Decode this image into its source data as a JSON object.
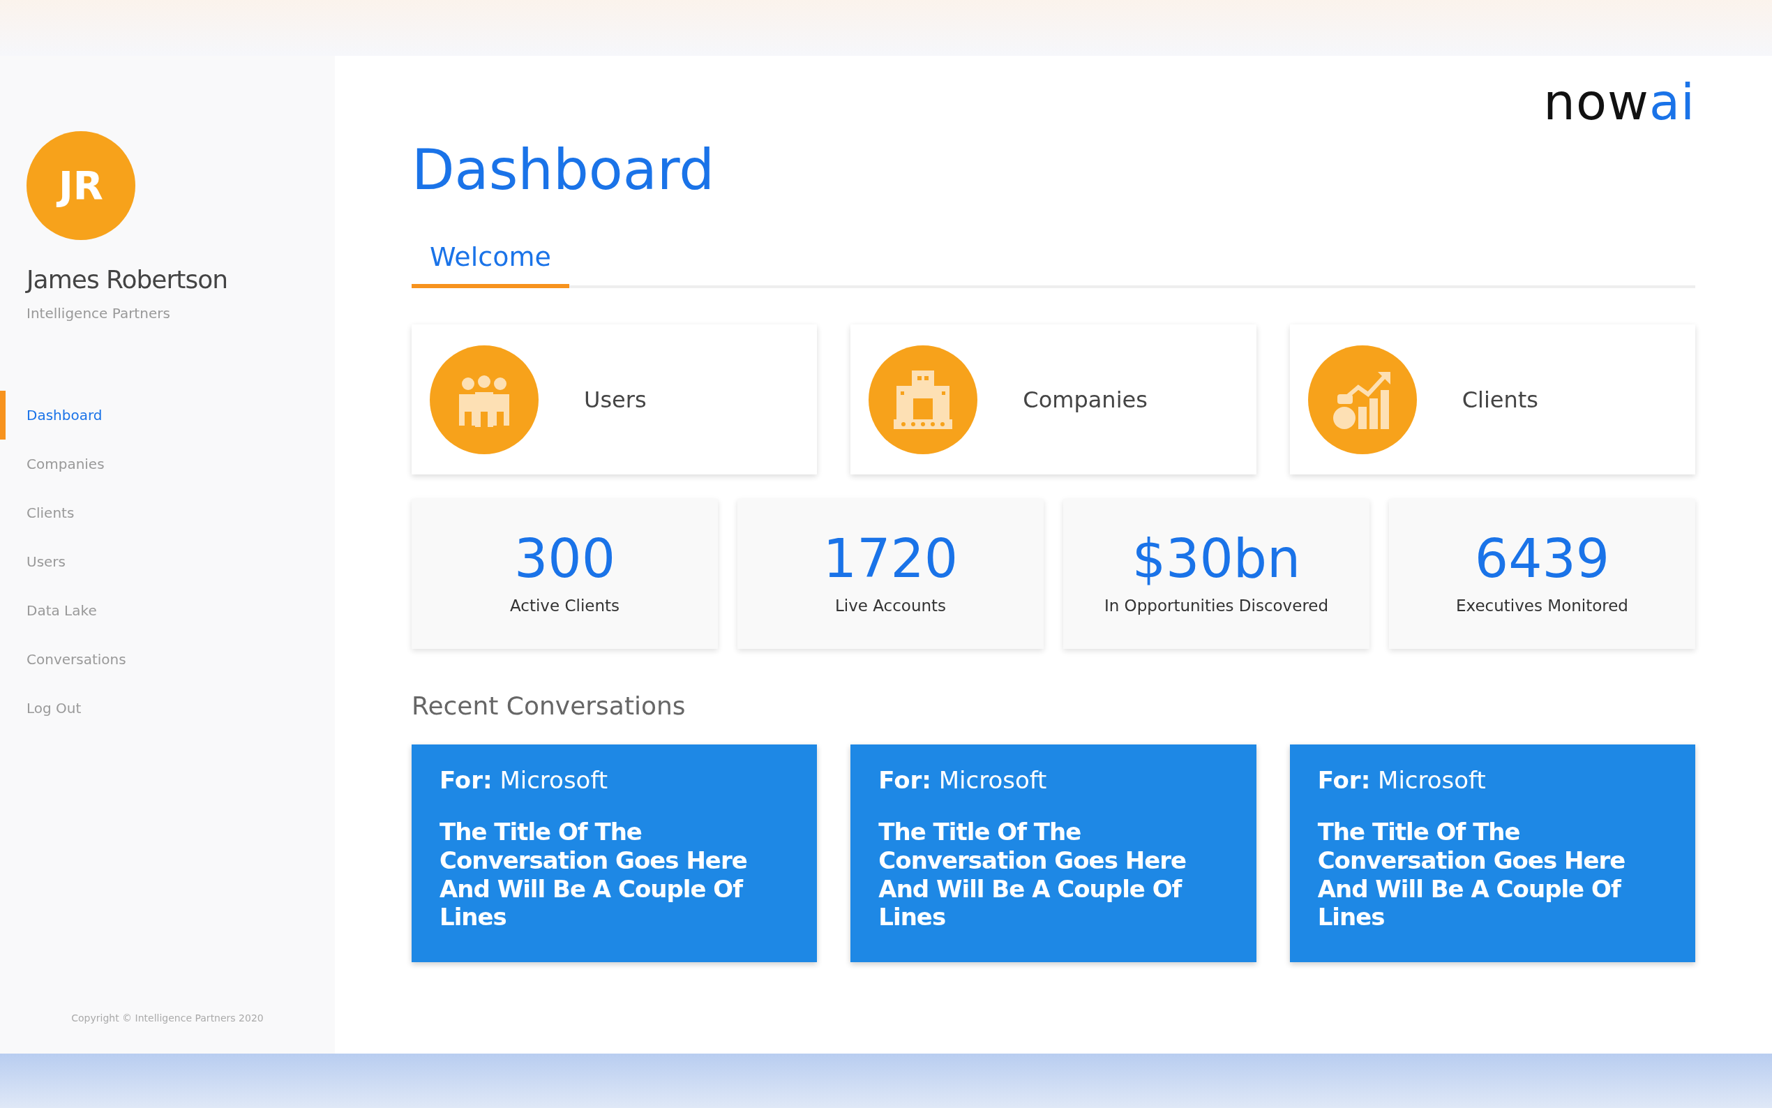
{
  "profile": {
    "initials": "JR",
    "name": "James Robertson",
    "company": "Intelligence Partners"
  },
  "sidebar": {
    "items": [
      {
        "label": "Dashboard",
        "selected": true
      },
      {
        "label": "Companies",
        "selected": false
      },
      {
        "label": "Clients",
        "selected": false
      },
      {
        "label": "Users",
        "selected": false
      },
      {
        "label": "Data Lake",
        "selected": false
      },
      {
        "label": "Conversations",
        "selected": false
      },
      {
        "label": "Log Out",
        "selected": false
      }
    ],
    "copyright": "Copyright © Intelligence Partners 2020"
  },
  "logo": {
    "text": "now",
    "accent": "ai"
  },
  "title": "Dashboard",
  "tabs": [
    {
      "label": "Welcome",
      "selected": true
    }
  ],
  "categories": [
    {
      "kind": "users",
      "label": "Users"
    },
    {
      "kind": "companies",
      "label": "Companies"
    },
    {
      "kind": "clients",
      "label": "Clients"
    }
  ],
  "stats": [
    {
      "value": "300",
      "label": "Active Clients"
    },
    {
      "value": "1720",
      "label": "Live Accounts"
    },
    {
      "value": "$30bn",
      "label": "In Opportunities Discovered"
    },
    {
      "value": "6439",
      "label": "Executives Monitored"
    }
  ],
  "recent": {
    "heading": "Recent Conversations",
    "items": [
      {
        "for": "**For:** Microsoft",
        "title": "The Title Of The Conversation Goes Here And Will Be A Couple Of Lines"
      },
      {
        "for": "**For:** Microsoft",
        "title": "The Title Of The Conversation Goes Here And Will Be A Couple Of Lines"
      },
      {
        "for": "**For:** Microsoft",
        "title": "The Title Of The Conversation Goes Here And Will Be A Couple Of Lines"
      }
    ]
  }
}
